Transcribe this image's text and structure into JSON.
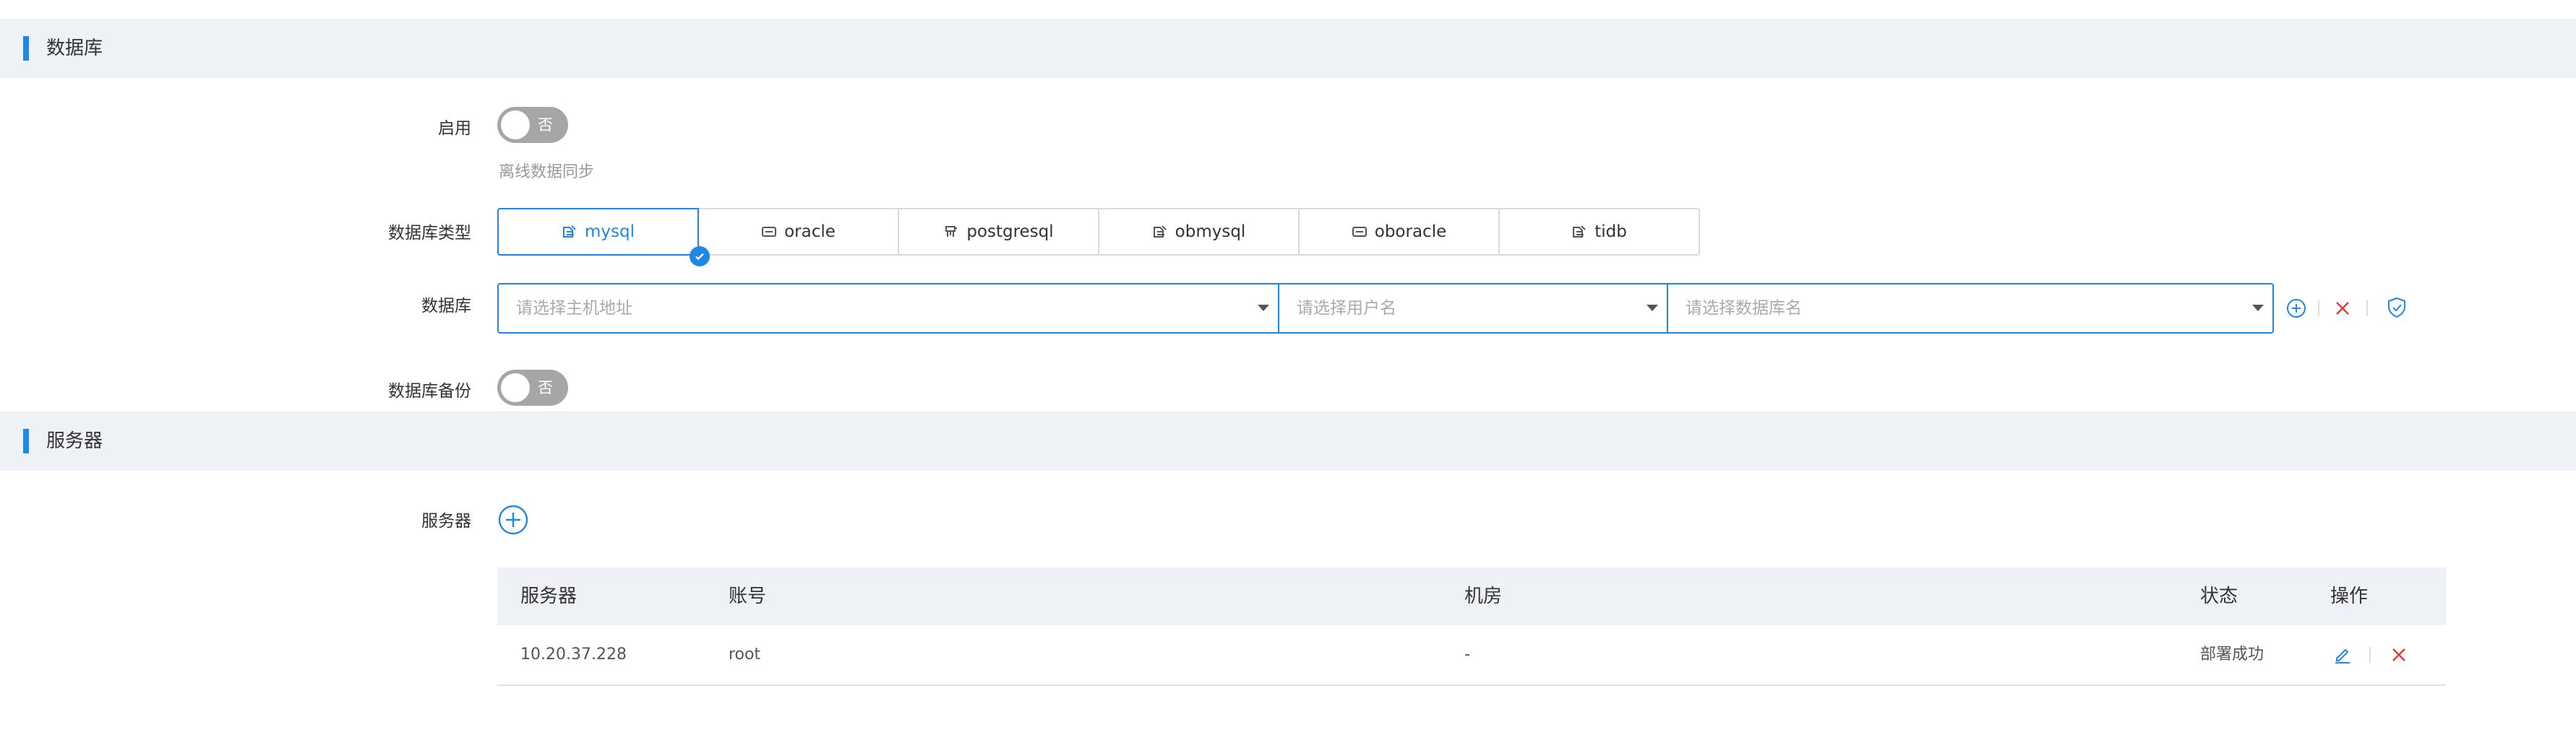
{
  "sections": {
    "database": {
      "title": "数据库"
    },
    "server": {
      "title": "服务器"
    }
  },
  "form": {
    "enable": {
      "label": "启用",
      "switch_text": "否",
      "help": "离线数据同步"
    },
    "db_type": {
      "label": "数据库类型",
      "selected": "mysql",
      "options": [
        {
          "label": "mysql",
          "icon": "database-icon"
        },
        {
          "label": "oracle",
          "icon": "server-box-icon"
        },
        {
          "label": "postgresql",
          "icon": "postgresql-icon"
        },
        {
          "label": "obmysql",
          "icon": "database-icon"
        },
        {
          "label": "oboracle",
          "icon": "server-box-icon"
        },
        {
          "label": "tidb",
          "icon": "database-icon"
        }
      ]
    },
    "database": {
      "label": "数据库",
      "host_placeholder": "请选择主机地址",
      "user_placeholder": "请选择用户名",
      "dbname_placeholder": "请选择数据库名"
    },
    "backup": {
      "label": "数据库备份",
      "switch_text": "否"
    },
    "server": {
      "label": "服务器"
    }
  },
  "table": {
    "columns": [
      "服务器",
      "账号",
      "机房",
      "状态",
      "操作"
    ],
    "rows": [
      {
        "server": "10.20.37.228",
        "account": "root",
        "room": "-",
        "status": "部署成功"
      }
    ]
  },
  "colors": {
    "accent": "#1e88e5",
    "danger": "#e53935",
    "header_bg": "#eef1f5",
    "switch_off": "#a6a6a6"
  }
}
